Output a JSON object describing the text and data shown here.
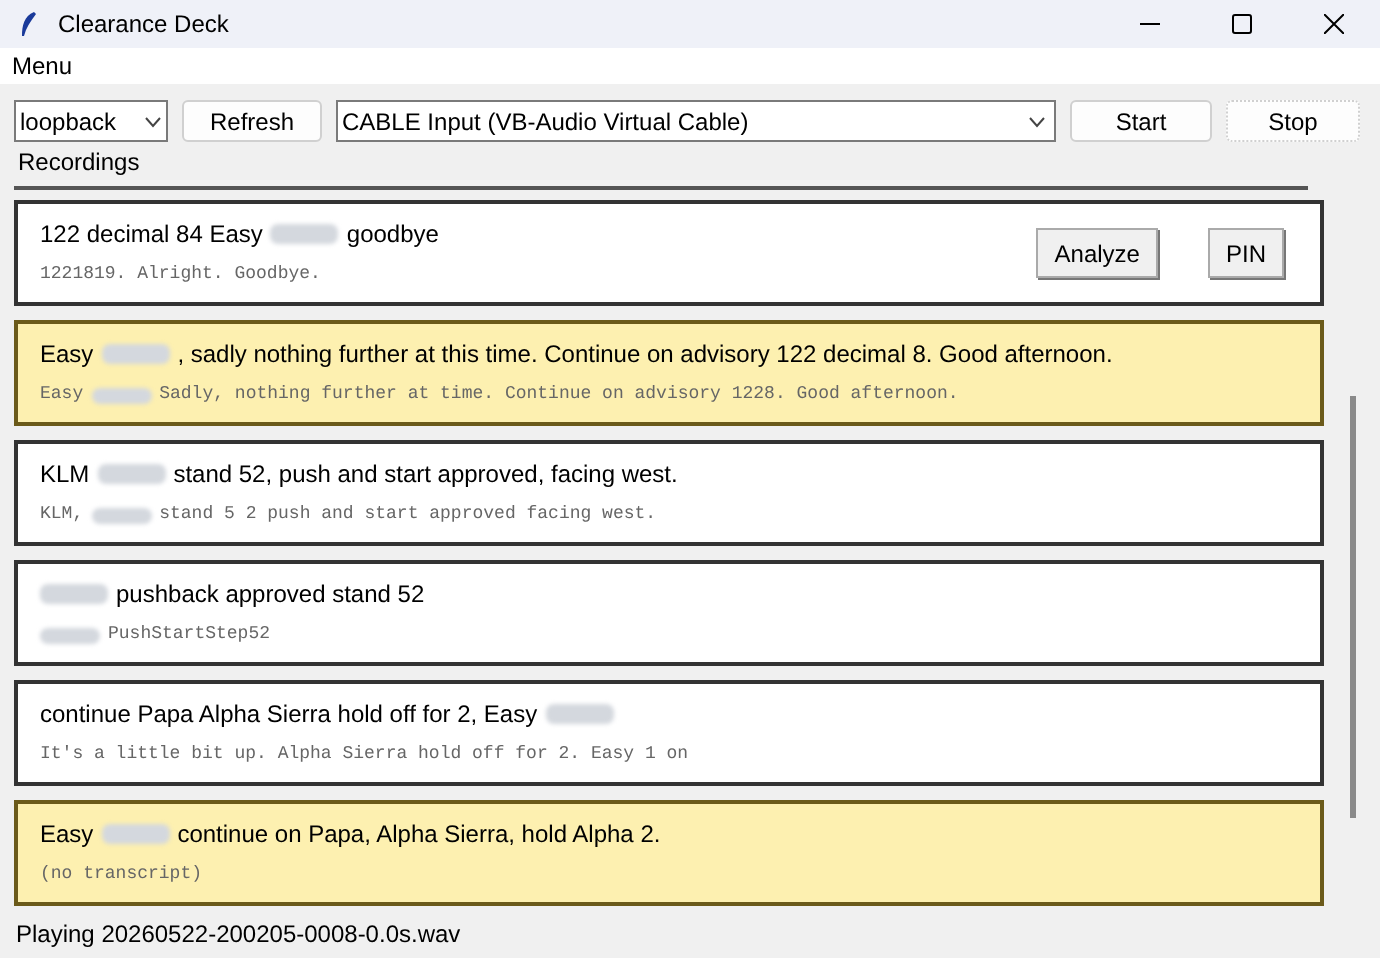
{
  "window": {
    "title": "Clearance Deck"
  },
  "menu": [
    "Menu"
  ],
  "toolbar": {
    "mode": "loopback",
    "refresh": "Refresh",
    "device": "CABLE Input (VB-Audio Virtual Cable)",
    "start": "Start",
    "stop": "Stop"
  },
  "section_title": "Recordings",
  "recordings": [
    {
      "highlighted": false,
      "title": [
        {
          "kind": "text",
          "text": "122 decimal 84 Easy"
        },
        {
          "kind": "redacted"
        },
        {
          "kind": "text",
          "text": "goodbye"
        }
      ],
      "transcript": [
        {
          "kind": "text",
          "text": "1221819. Alright. Goodbye."
        }
      ],
      "actions": [
        "Analyze",
        "PIN"
      ]
    },
    {
      "highlighted": true,
      "title": [
        {
          "kind": "text",
          "text": "Easy"
        },
        {
          "kind": "redacted"
        },
        {
          "kind": "text",
          "text": ", sadly nothing further at this time. Continue on advisory 122 decimal 8. Good afternoon."
        }
      ],
      "transcript": [
        {
          "kind": "text",
          "text": "Easy"
        },
        {
          "kind": "redacted"
        },
        {
          "kind": "text",
          "text": "Sadly, nothing further at time. Continue on advisory 1228. Good afternoon."
        }
      ]
    },
    {
      "highlighted": false,
      "title": [
        {
          "kind": "text",
          "text": "KLM"
        },
        {
          "kind": "redacted"
        },
        {
          "kind": "text",
          "text": "stand 52, push and start approved, facing west."
        }
      ],
      "transcript": [
        {
          "kind": "text",
          "text": "KLM,"
        },
        {
          "kind": "redacted"
        },
        {
          "kind": "text",
          "text": "stand 5 2 push and start approved facing west."
        }
      ]
    },
    {
      "highlighted": false,
      "title": [
        {
          "kind": "redacted"
        },
        {
          "kind": "text",
          "text": "pushback approved stand 52"
        }
      ],
      "transcript": [
        {
          "kind": "redacted"
        },
        {
          "kind": "text",
          "text": "PushStartStep52"
        }
      ]
    },
    {
      "highlighted": false,
      "title": [
        {
          "kind": "text",
          "text": "continue Papa Alpha Sierra hold off for 2, Easy"
        },
        {
          "kind": "redacted"
        }
      ],
      "transcript": [
        {
          "kind": "text",
          "text": "It's a little bit up. Alpha Sierra hold off for 2. Easy 1 on"
        }
      ]
    },
    {
      "highlighted": true,
      "title": [
        {
          "kind": "text",
          "text": "Easy"
        },
        {
          "kind": "redacted"
        },
        {
          "kind": "text",
          "text": "continue on Papa, Alpha Sierra, hold Alpha 2."
        }
      ],
      "transcript": [
        {
          "kind": "text",
          "text": "(no transcript)"
        }
      ]
    }
  ],
  "status_bar": "Playing 20260522-200205-0008-0.0s.wav"
}
